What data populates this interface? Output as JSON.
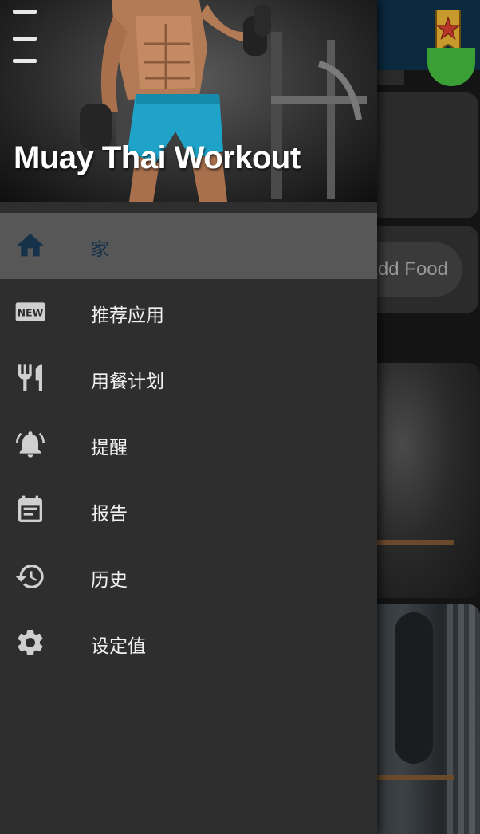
{
  "app": {
    "title": "Muay Thai Workout"
  },
  "drawer": {
    "items": [
      {
        "label": "家",
        "icon": "home-icon",
        "active": true
      },
      {
        "label": "推荐应用",
        "icon": "new-badge-icon",
        "active": false
      },
      {
        "label": "用餐计划",
        "icon": "fork-knife-icon",
        "active": false
      },
      {
        "label": "提醒",
        "icon": "bell-icon",
        "active": false
      },
      {
        "label": "报告",
        "icon": "calendar-report-icon",
        "active": false
      },
      {
        "label": "历史",
        "icon": "history-icon",
        "active": false
      },
      {
        "label": "设定值",
        "icon": "gear-icon",
        "active": false
      }
    ]
  },
  "background": {
    "add_food_label": "Add Food"
  },
  "colors": {
    "drawer_bg": "#2e2e2e",
    "active_item_bg": "#575757",
    "active_icon": "#16324a",
    "icon_default": "#cfcfcf",
    "topbar": "#0b2a3f",
    "accent_green": "#3aa035"
  }
}
